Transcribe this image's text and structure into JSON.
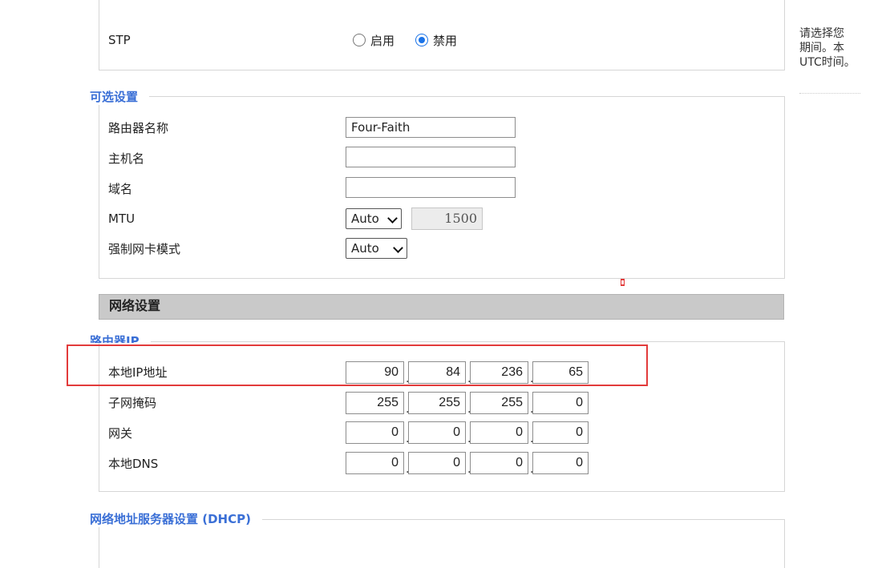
{
  "stp": {
    "label": "STP",
    "options": [
      {
        "label": "启用",
        "selected": false
      },
      {
        "label": "禁用",
        "selected": true
      }
    ]
  },
  "help": {
    "lines": [
      "请选择您",
      "期间。本",
      "UTC时间。"
    ]
  },
  "optional": {
    "legend": "可选设置",
    "router_name_label": "路由器名称",
    "router_name_value": "Four-Faith",
    "hostname_label": "主机名",
    "hostname_value": "",
    "domain_label": "域名",
    "domain_value": "",
    "mtu_label": "MTU",
    "mtu_select": "Auto",
    "mtu_value": "1500",
    "nic_mode_label": "强制网卡模式",
    "nic_mode_select": "Auto"
  },
  "network": {
    "section_title": "网络设置",
    "router_ip_legend": "路由器IP",
    "rows": [
      {
        "label": "本地IP地址",
        "octets": [
          "90",
          "84",
          "236",
          "65"
        ]
      },
      {
        "label": "子网掩码",
        "octets": [
          "255",
          "255",
          "255",
          "0"
        ]
      },
      {
        "label": "网关",
        "octets": [
          "0",
          "0",
          "0",
          "0"
        ]
      },
      {
        "label": "本地DNS",
        "octets": [
          "0",
          "0",
          "0",
          "0"
        ]
      }
    ]
  },
  "dhcp": {
    "legend": "网络地址服务器设置 (DHCP)"
  },
  "colors": {
    "legend_blue": "#3a6fd6",
    "annotation_red": "#e23b3b",
    "section_bar_gray": "#c9c9c9"
  }
}
